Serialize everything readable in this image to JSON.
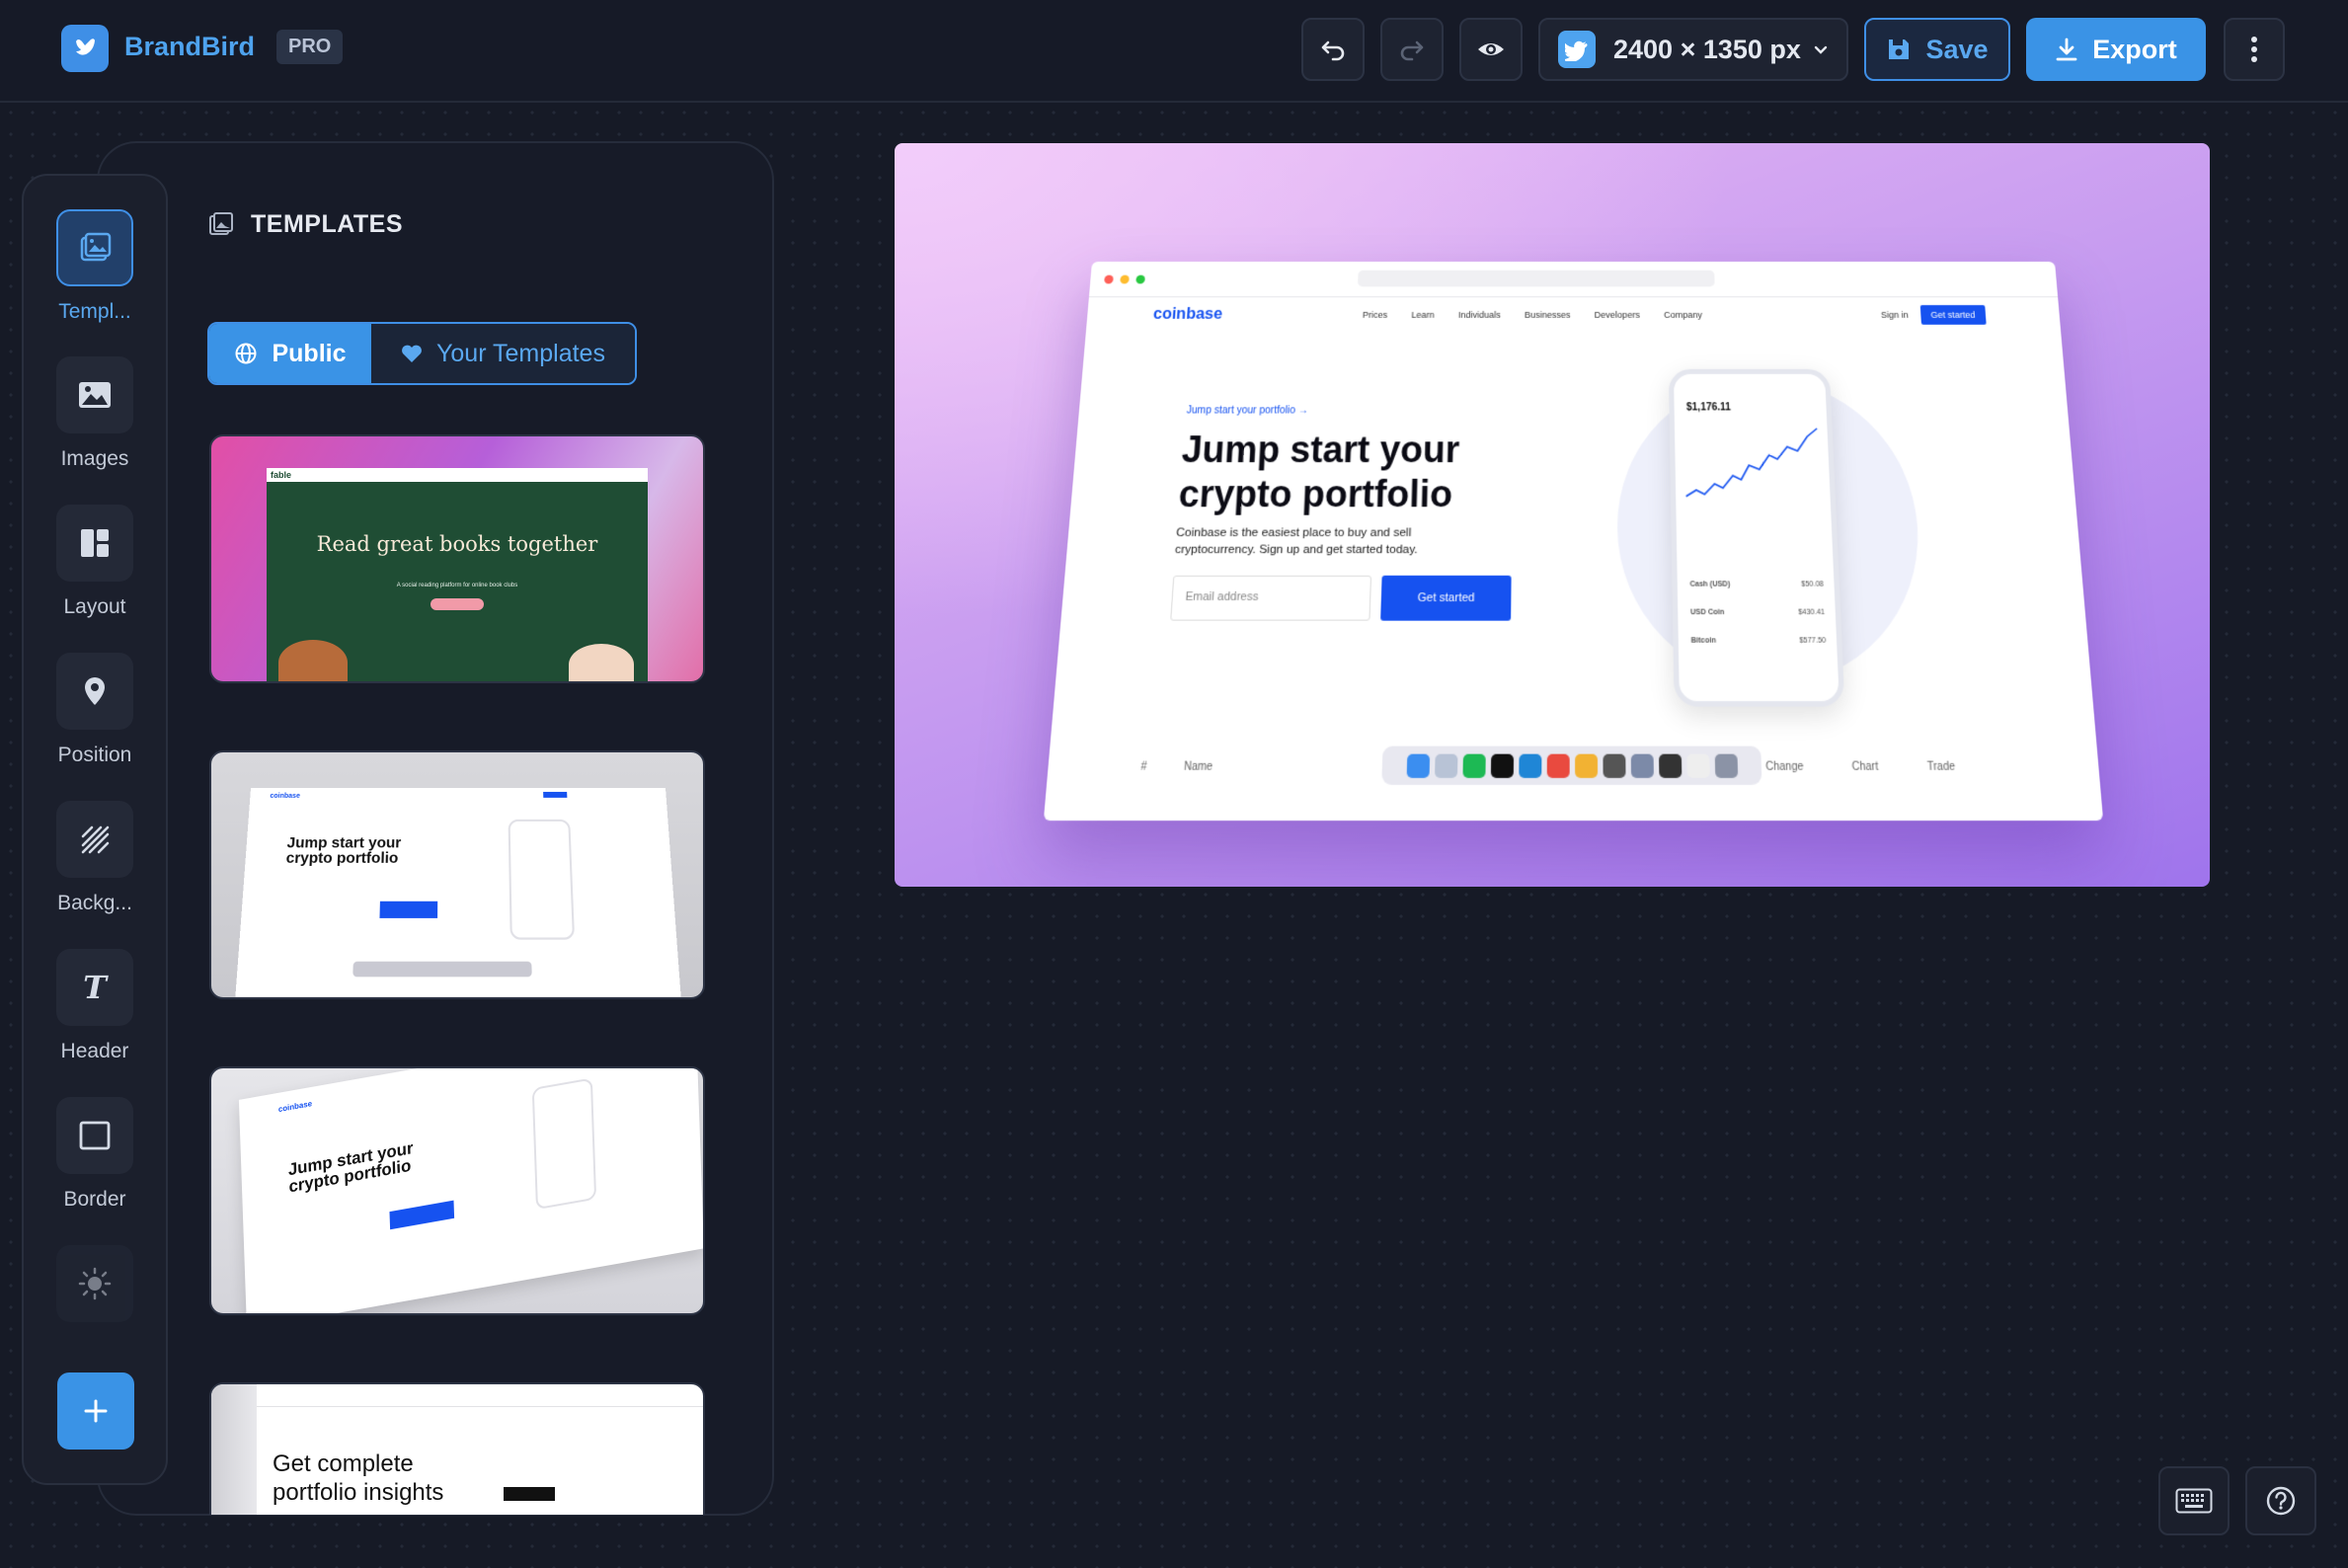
{
  "app": {
    "brand": "BrandBird",
    "plan_badge": "PRO"
  },
  "toolbar": {
    "undo_icon": "undo-icon",
    "redo_icon": "redo-icon",
    "preview_icon": "eye-icon",
    "size_label": "2400 × 1350 px",
    "platform_icon": "twitter-icon",
    "save_label": "Save",
    "export_label": "Export",
    "more_icon": "more-vertical-icon"
  },
  "rail": {
    "items": [
      {
        "label": "Templ...",
        "icon": "templates-icon",
        "active": true
      },
      {
        "label": "Images",
        "icon": "image-icon"
      },
      {
        "label": "Layout",
        "icon": "layout-icon"
      },
      {
        "label": "Position",
        "icon": "location-pin-icon"
      },
      {
        "label": "Backg...",
        "icon": "background-pattern-icon"
      },
      {
        "label": "Header",
        "icon": "text-icon"
      },
      {
        "label": "Border",
        "icon": "square-icon"
      },
      {
        "label": "",
        "icon": "brightness-icon"
      }
    ],
    "add_icon": "plus-icon"
  },
  "templates": {
    "title": "TEMPLATES",
    "tabs": {
      "public": "Public",
      "yours": "Your Templates"
    },
    "thumbs": [
      {
        "headline": "Read great books together",
        "sub": "A social reading platform for online book clubs",
        "logo": "fable"
      },
      {
        "headline": "Jump start your crypto portfolio"
      },
      {
        "headline": "Jump start your crypto portfolio"
      },
      {
        "headline": "Get complete portfolio insights"
      }
    ]
  },
  "canvas": {
    "site": {
      "logo": "coinbase",
      "nav": [
        "Prices",
        "Learn",
        "Individuals",
        "Businesses",
        "Developers",
        "Company"
      ],
      "sign_in": "Sign in",
      "cta": "Get started",
      "tag": "Jump start your portfolio →",
      "headline": "Jump start your crypto portfolio",
      "body": "Coinbase is the easiest place to buy and sell cryptocurrency. Sign up and get started today.",
      "email_placeholder": "Email address",
      "button": "Get started",
      "phone_balance": "$1,176.11",
      "phone_rows": [
        {
          "name": "Cash (USD)",
          "value": "$50.08"
        },
        {
          "name": "USD Coin",
          "value": "$430.41"
        },
        {
          "name": "Bitcoin",
          "value": "$577.50"
        }
      ],
      "table_headers": [
        "#",
        "Name",
        "Change",
        "Chart",
        "Trade"
      ]
    },
    "gradient_start": "#f2cdfa",
    "gradient_end": "#9f74ec"
  },
  "footer": {
    "keyboard_icon": "keyboard-icon",
    "help_icon": "help-icon"
  }
}
